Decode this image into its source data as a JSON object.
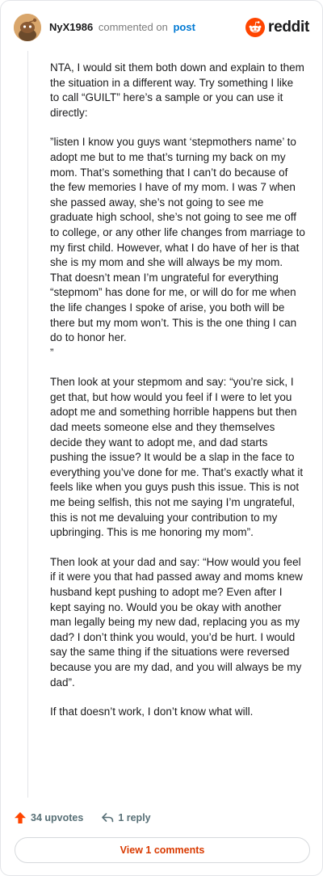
{
  "header": {
    "username": "NyX1986",
    "action_text": "commented on",
    "post_link": "post",
    "brand": "reddit"
  },
  "comment": {
    "paragraphs": [
      "NTA, I would sit them both down and explain to them the situation in a different way. Try something I like to call “GUILT” here’s a sample or you can use it directly:",
      "”listen I know you guys want ‘stepmothers name’ to adopt me but to me that’s turning my back on my mom. That’s something that I can’t do because of the few memories I have of my mom. I was 7 when she passed away, she’s not going to see me graduate high school, she’s not going to see me off to college, or any other life changes from marriage to my first child. However, what I do have of her is that she is my mom and she will always be my mom. That doesn’t mean I’m ungrateful for everything “stepmom” has done for me, or will do for me when the life changes I spoke of arise, you both will be there but my mom won’t. This is the one thing I can do to honor her.\n”",
      "Then look at your stepmom and say: “you’re sick, I get that, but how would you feel if I were to let you adopt me and something horrible happens but then dad meets someone else and they themselves decide they want to adopt me, and dad starts pushing the issue? It would be a slap in the face to everything you’ve done for me. That’s exactly what it feels like when you guys push this issue. This is not me being selfish, this not me saying I’m ungrateful, this is not me devaluing your contribution to my upbringing. This is me honoring my mom”.",
      "Then look at your dad and say: “How would you feel if it were you that had passed away and moms knew husband kept pushing to adopt me? Even after I kept saying no. Would you be okay with another man legally being my new dad, replacing you as my dad? I don’t think you would, you’d be hurt. I would say the same thing if the situations were reversed because you are my dad, and you will always be my dad”.",
      "If that doesn’t work, I don’t know what will."
    ]
  },
  "actions": {
    "upvotes": "34 upvotes",
    "replies": "1 reply"
  },
  "footer": {
    "view_comments": "View 1 comments"
  },
  "colors": {
    "accent": "#ff4500",
    "link": "#0079d3",
    "view_button_text": "#d93a00",
    "muted": "#576f76"
  },
  "icons": {
    "avatar": "snoo-avatar",
    "brand": "reddit-snoo-icon",
    "upvote": "upvote-arrow-icon",
    "reply": "reply-arrow-icon"
  }
}
